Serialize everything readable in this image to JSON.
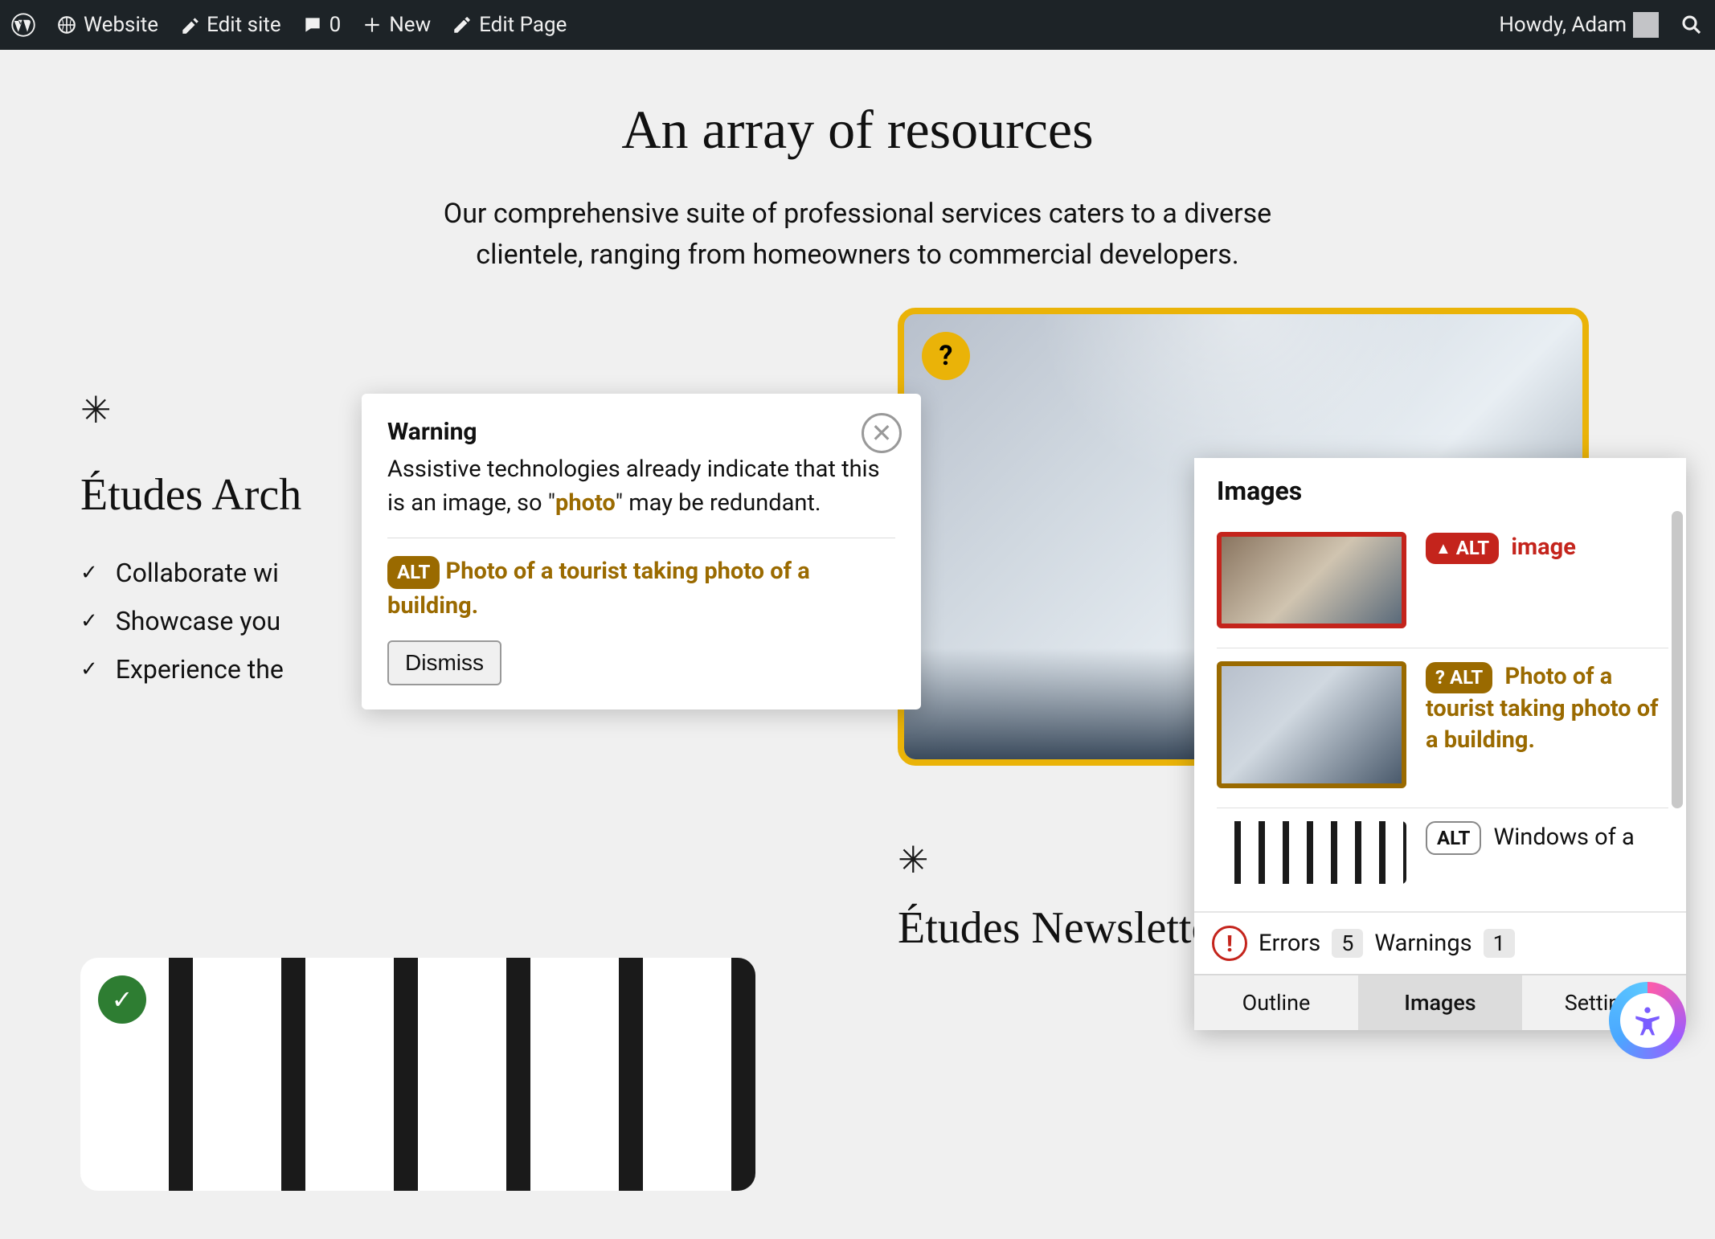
{
  "adminbar": {
    "site_label": "Website",
    "edit_site": "Edit site",
    "comments_count": "0",
    "new_label": "New",
    "edit_page": "Edit Page",
    "howdy": "Howdy, Adam"
  },
  "hero": {
    "title": "An array of resources",
    "subtitle": "Our comprehensive suite of professional services caters to a diverse clientele, ranging from homeowners to commercial developers."
  },
  "left_col": {
    "heading": "Études Arch",
    "items": [
      "Collaborate wi",
      "Showcase you",
      "Experience the"
    ]
  },
  "right_col": {
    "newsletter_heading": "Études Newsletter"
  },
  "popover": {
    "title": "Warning",
    "body_pre": "Assistive technologies already indicate that this is an image, so \"",
    "body_hl": "photo",
    "body_post": "\" may be redundant.",
    "alt_label": "ALT",
    "alt_text": "Photo of a tourist taking photo of a building.",
    "dismiss": "Dismiss"
  },
  "panel": {
    "header": "Images",
    "rows": [
      {
        "kind": "err",
        "badge_icon": "▲",
        "badge": "ALT",
        "text": "image"
      },
      {
        "kind": "warn",
        "badge_icon": "?",
        "badge": "ALT",
        "text": "Photo of a tourist taking photo of a building."
      },
      {
        "kind": "ok",
        "badge": "ALT",
        "text": "Windows of a"
      }
    ],
    "summary": {
      "errors_label": "Errors",
      "errors_count": "5",
      "warnings_label": "Warnings",
      "warnings_count": "1"
    },
    "tabs": [
      "Outline",
      "Images",
      "Settings"
    ],
    "active_tab": 1
  },
  "question_badge": "?"
}
